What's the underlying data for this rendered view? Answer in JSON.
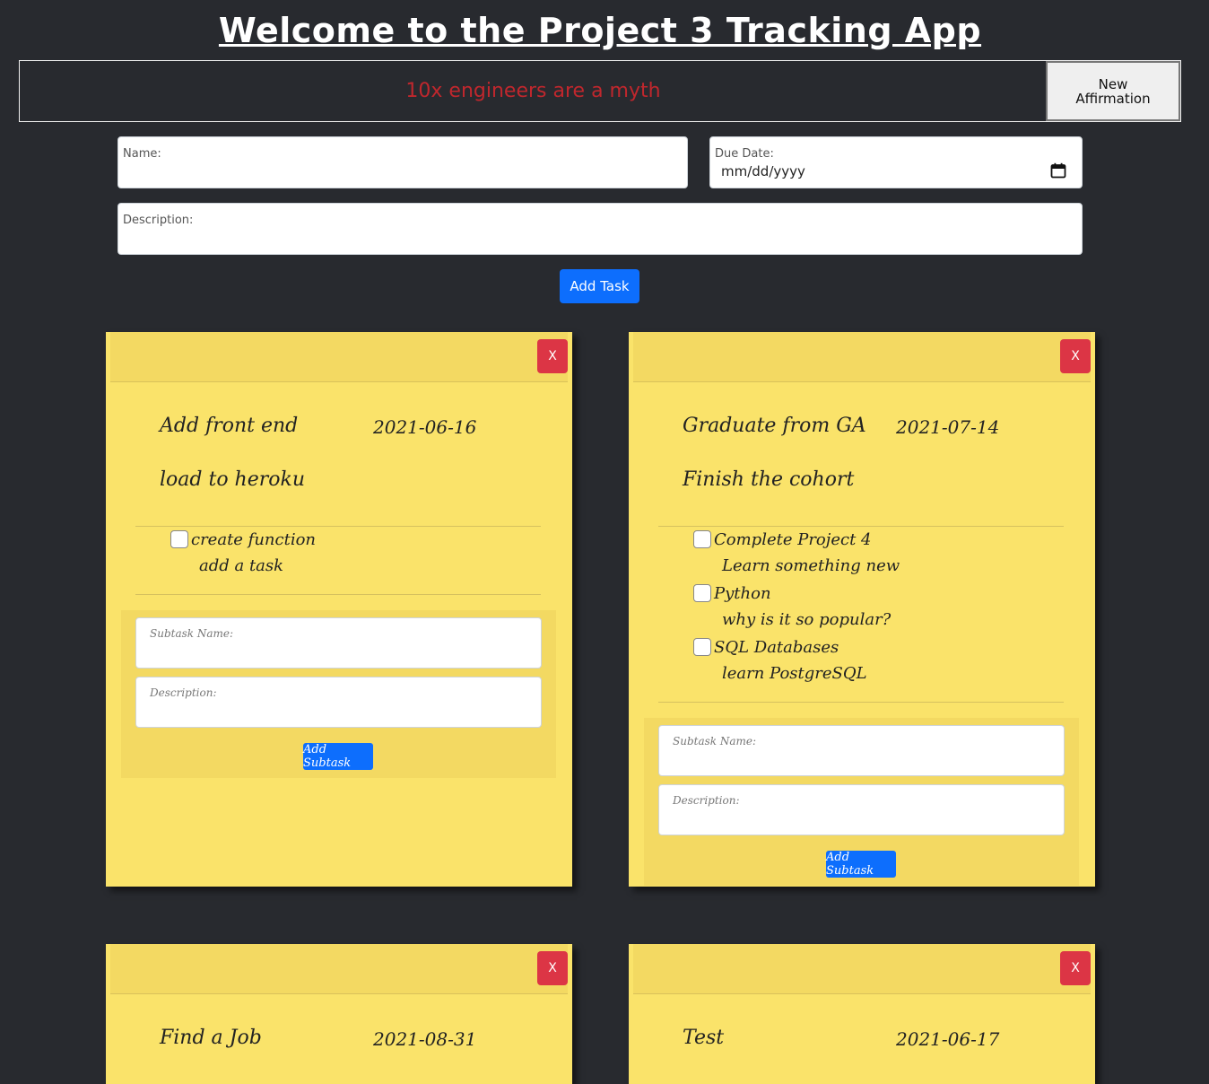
{
  "header": {
    "title": "Welcome to the Project 3 Tracking App"
  },
  "affirmation": {
    "text": "10x engineers are a myth",
    "button_label": "New\nAffirmation",
    "text_color": "#c0272d"
  },
  "task_form": {
    "name_label": "Name:",
    "name_value": "",
    "due_date_label": "Due Date:",
    "due_date_value": "mm/dd/yyyy",
    "description_label": "Description:",
    "description_value": "",
    "add_task_label": "Add Task"
  },
  "colors": {
    "note_bg": "#fae36a",
    "note_header": "#f3d962",
    "primary": "#0d6efd",
    "danger": "#dc3545",
    "page_bg": "#282a2f"
  },
  "notes": [
    {
      "close_label": "X",
      "name": "Add front end",
      "due_date": "2021-06-16",
      "description": "load to heroku",
      "subtasks": [
        {
          "name": "create function",
          "description": "add a task",
          "checked": false
        }
      ],
      "subtask_form": {
        "name_label": "Subtask Name:",
        "description_label": "Description:",
        "button_label": "Add Subtask"
      }
    },
    {
      "close_label": "X",
      "name": "Graduate from GA",
      "due_date": "2021-07-14",
      "description": "Finish the cohort",
      "subtasks": [
        {
          "name": "Complete Project 4",
          "description": "Learn something new",
          "checked": false
        },
        {
          "name": "Python",
          "description": "why is it so popular?",
          "checked": false
        },
        {
          "name": "SQL Databases",
          "description": "learn PostgreSQL",
          "checked": false
        }
      ],
      "subtask_form": {
        "name_label": "Subtask Name:",
        "description_label": "Description:",
        "button_label": "Add Subtask"
      }
    },
    {
      "close_label": "X",
      "name": "Find a Job",
      "due_date": "2021-08-31"
    },
    {
      "close_label": "X",
      "name": "Test",
      "due_date": "2021-06-17"
    }
  ]
}
